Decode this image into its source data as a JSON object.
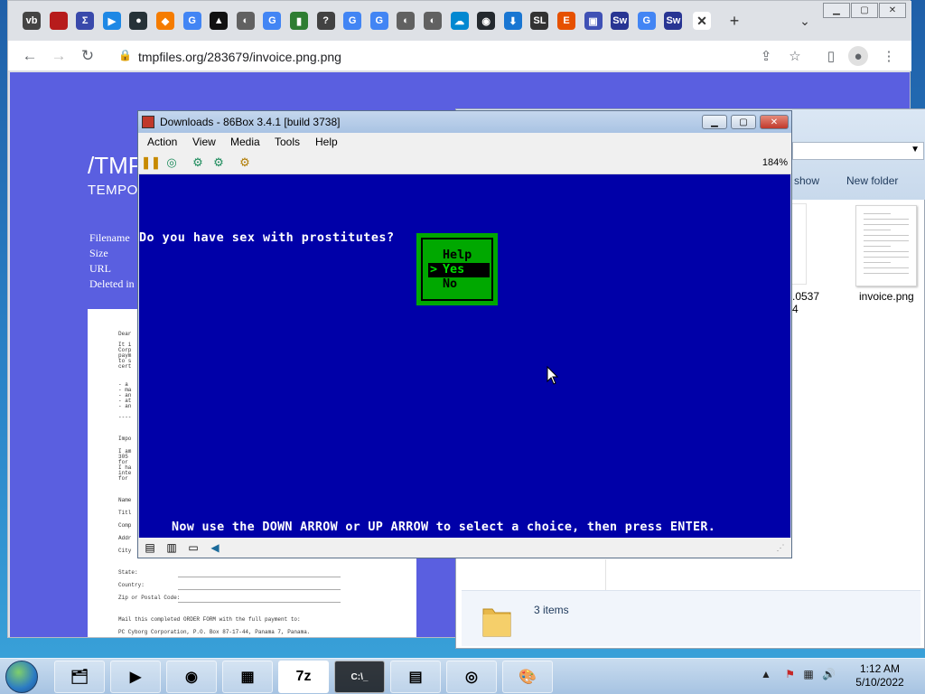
{
  "browser": {
    "url": "tmpfiles.org/283679/invoice.png.png",
    "new_tab": "+",
    "tab_list": "⌄",
    "pinned_tabs": [
      {
        "name": "vb-icon",
        "glyph": "vb",
        "bg": "#444444"
      },
      {
        "name": "red-square-icon",
        "glyph": "",
        "bg": "#b71c1c"
      },
      {
        "name": "sigma-icon",
        "glyph": "Σ",
        "bg": "#3949ab"
      },
      {
        "name": "play-icon",
        "glyph": "▶",
        "bg": "#1e88e5"
      },
      {
        "name": "orbit-icon",
        "glyph": "●",
        "bg": "#263238"
      },
      {
        "name": "diamond-icon",
        "glyph": "◆",
        "bg": "#f57c00"
      },
      {
        "name": "google-icon",
        "glyph": "G",
        "bg": "#4285f4"
      },
      {
        "name": "mountain-icon",
        "glyph": "▲",
        "bg": "#111111"
      },
      {
        "name": "globe-icon",
        "glyph": "◐",
        "bg": "#616161"
      },
      {
        "name": "google-icon",
        "glyph": "G",
        "bg": "#4285f4"
      },
      {
        "name": "bars-icon",
        "glyph": "▮",
        "bg": "#2e7d32"
      },
      {
        "name": "question-icon",
        "glyph": "?",
        "bg": "#424242"
      },
      {
        "name": "google-icon",
        "glyph": "G",
        "bg": "#4285f4"
      },
      {
        "name": "google-icon",
        "glyph": "G",
        "bg": "#4285f4"
      },
      {
        "name": "globe-icon",
        "glyph": "◐",
        "bg": "#616161"
      },
      {
        "name": "globe-icon",
        "glyph": "◐",
        "bg": "#616161"
      },
      {
        "name": "cloud-icon",
        "glyph": "☁",
        "bg": "#0288d1"
      },
      {
        "name": "github-icon",
        "glyph": "◉",
        "bg": "#24292e"
      },
      {
        "name": "download-icon",
        "glyph": "⬇",
        "bg": "#1976d2"
      },
      {
        "name": "sl-icon",
        "glyph": "SL",
        "bg": "#333333"
      },
      {
        "name": "e-icon",
        "glyph": "E",
        "bg": "#e65100"
      },
      {
        "name": "save-icon",
        "glyph": "▣",
        "bg": "#3f51b5"
      },
      {
        "name": "sw-icon",
        "glyph": "Sw",
        "bg": "#283593"
      },
      {
        "name": "google-icon",
        "glyph": "G",
        "bg": "#4285f4"
      },
      {
        "name": "sw-icon",
        "glyph": "Sw",
        "bg": "#283593"
      }
    ]
  },
  "webpage": {
    "title": "/TMP",
    "subtitle": "TEMPO",
    "labels": [
      "Filename",
      "Size",
      "URL",
      "Deleted in"
    ],
    "document_lines": [
      "Dear",
      "It i",
      "Corp",
      "paym",
      "to s",
      "cert",
      "- a",
      "- ma",
      "- an",
      "- at",
      "- an",
      "----",
      "Impo",
      "I am",
      "305",
      "for",
      "I ha",
      "inte",
      "for",
      "Name",
      "Titl",
      "Comp",
      "Addr",
      "City",
      "State:",
      "Country:",
      "Zip or Postal Code:",
      "Mail this completed ORDER FORM with the full payment to:",
      "PC Cyborg Corporation, P.O. Box 87-17-44, Panama 7, Panama."
    ]
  },
  "explorer": {
    "cmd_show": "show",
    "cmd_new_folder": "New folder",
    "file_partial": ".0537",
    "file_partial2": "4",
    "file_name": "invoice.png",
    "status": "3 items"
  },
  "emulator": {
    "title": "Downloads - 86Box 3.4.1 [build 3738]",
    "menus": [
      "Action",
      "View",
      "Media",
      "Tools",
      "Help"
    ],
    "zoom": "184%",
    "question": "Do you have sex with prostitutes?",
    "options": [
      "Help",
      "Yes",
      "No"
    ],
    "selected_index": 1,
    "marker": ">",
    "hint": "Now use the DOWN ARROW or UP ARROW to select a choice, then press ENTER."
  },
  "taskbar": {
    "apps": [
      {
        "name": "explorer-taskbar-icon",
        "glyph": "🗂"
      },
      {
        "name": "media-player-taskbar-icon",
        "glyph": "▶"
      },
      {
        "name": "chrome-taskbar-icon",
        "glyph": "◉"
      },
      {
        "name": "86box-taskbar-icon",
        "glyph": "▦"
      },
      {
        "name": "7zip-taskbar-icon",
        "glyph": "7z"
      },
      {
        "name": "cmd-taskbar-icon",
        "glyph": "C:\\_"
      },
      {
        "name": "notepad-taskbar-icon",
        "glyph": "▤"
      },
      {
        "name": "disc-taskbar-icon",
        "glyph": "◎"
      },
      {
        "name": "paint-taskbar-icon",
        "glyph": "🎨"
      }
    ],
    "time": "1:12 AM",
    "date": "5/10/2022"
  }
}
